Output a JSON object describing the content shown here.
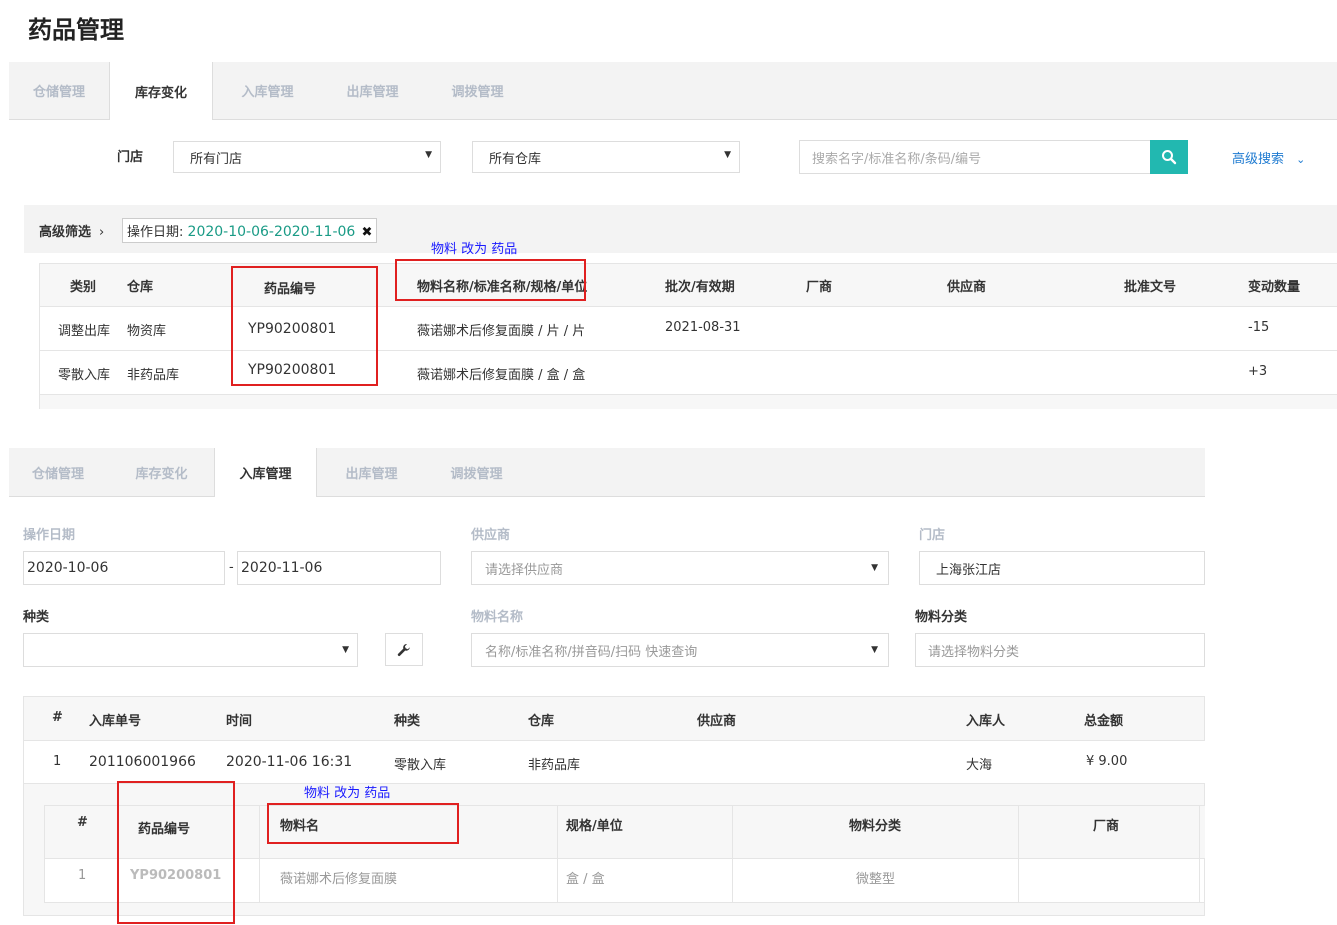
{
  "page_title": "药品管理",
  "top_tabs": [
    "仓储管理",
    "库存变化",
    "入库管理",
    "出库管理",
    "调拨管理"
  ],
  "filter": {
    "store_label": "门店",
    "store_value": "所有门店",
    "warehouse_value": "所有仓库",
    "search_placeholder": "搜索名字/标准名称/条码/编号",
    "advanced_search": "高级搜索"
  },
  "adv_filter": {
    "label": "高级筛选",
    "tag_label": "操作日期:",
    "tag_value": "2020-10-06-2020-11-06"
  },
  "annotation_1": "物料 改为 药品",
  "stock_table": {
    "headers": [
      "类别",
      "仓库",
      "药品编号",
      "物料名称/标准名称/规格/单位",
      "批次/有效期",
      "厂商",
      "供应商",
      "批准文号",
      "变动数量"
    ],
    "rows": [
      {
        "category": "调整出库",
        "warehouse": "物资库",
        "code": "YP90200801",
        "name": "薇诺娜术后修复面膜 / 片 / 片",
        "batch": "2021-08-31",
        "qty": "-15"
      },
      {
        "category": "零散入库",
        "warehouse": "非药品库",
        "code": "YP90200801",
        "name": "薇诺娜术后修复面膜 / 盒 / 盒",
        "batch": "",
        "qty": "+3"
      }
    ]
  },
  "bottom_tabs": [
    "仓储管理",
    "库存变化",
    "入库管理",
    "出库管理",
    "调拨管理"
  ],
  "inbound_form": {
    "date_label": "操作日期",
    "date_from": "2020-10-06",
    "date_sep": "-",
    "date_to": "2020-11-06",
    "supplier_label": "供应商",
    "supplier_placeholder": "请选择供应商",
    "store_label": "门店",
    "store_value": "上海张江店",
    "kind_label": "种类",
    "material_name_label": "物料名称",
    "material_name_placeholder": "名称/标准名称/拼音码/扫码 快速查询",
    "material_cat_label": "物料分类",
    "material_cat_placeholder": "请选择物料分类"
  },
  "inbound_table": {
    "headers": [
      "#",
      "入库单号",
      "时间",
      "种类",
      "仓库",
      "供应商",
      "入库人",
      "总金额"
    ],
    "row": {
      "num": "1",
      "order_no": "201106001966",
      "time": "2020-11-06 16:31",
      "kind": "零散入库",
      "warehouse": "非药品库",
      "supplier": "",
      "person": "大海",
      "amount": "¥ 9.00"
    }
  },
  "annotation_2": "物料 改为 药品",
  "detail_table": {
    "headers": [
      "#",
      "药品编号",
      "物料名",
      "规格/单位",
      "物料分类",
      "厂商"
    ],
    "row": {
      "num": "1",
      "code": "YP90200801",
      "name": "薇诺娜术后修复面膜",
      "spec": "盒 / 盒",
      "category": "微整型",
      "maker": ""
    }
  }
}
